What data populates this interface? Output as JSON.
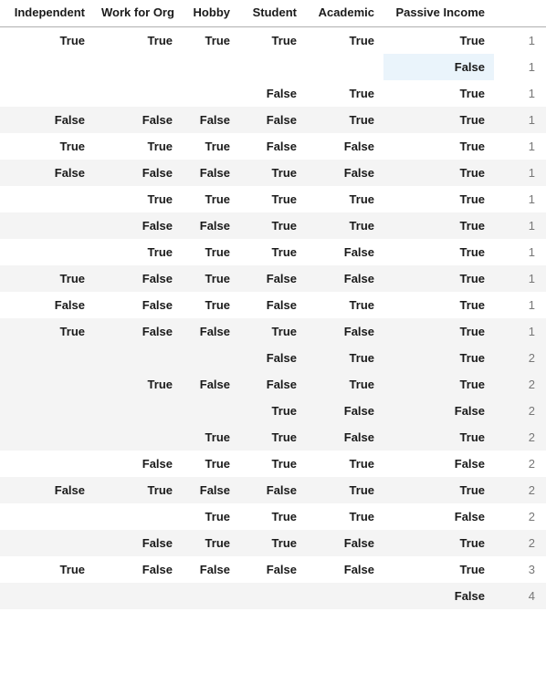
{
  "columns": [
    {
      "key": "independent",
      "label": "Independent"
    },
    {
      "key": "workfororg",
      "label": "Work for Org"
    },
    {
      "key": "hobby",
      "label": "Hobby"
    },
    {
      "key": "student",
      "label": "Student"
    },
    {
      "key": "academic",
      "label": "Academic"
    },
    {
      "key": "passiveincome",
      "label": "Passive Income"
    }
  ],
  "rows": [
    {
      "independent": "True",
      "workfororg": "True",
      "hobby": "True",
      "student": "True",
      "academic": "True",
      "passiveincome": "True",
      "count": "1"
    },
    {
      "independent": "",
      "workfororg": "",
      "hobby": "",
      "student": "",
      "academic": "",
      "passiveincome": "False",
      "count": "1",
      "passive_highlight": true
    },
    {
      "independent": "",
      "workfororg": "",
      "hobby": "",
      "student": "False",
      "academic": "True",
      "passiveincome": "True",
      "count": "1"
    },
    {
      "independent": "False",
      "workfororg": "False",
      "hobby": "False",
      "student": "False",
      "academic": "True",
      "passiveincome": "True",
      "count": "1"
    },
    {
      "independent": "True",
      "workfororg": "True",
      "hobby": "True",
      "student": "False",
      "academic": "False",
      "passiveincome": "True",
      "count": "1"
    },
    {
      "independent": "False",
      "workfororg": "False",
      "hobby": "False",
      "student": "True",
      "academic": "False",
      "passiveincome": "True",
      "count": "1"
    },
    {
      "independent": "",
      "workfororg": "True",
      "hobby": "True",
      "student": "True",
      "academic": "True",
      "passiveincome": "True",
      "count": "1"
    },
    {
      "independent": "",
      "workfororg": "False",
      "hobby": "False",
      "student": "True",
      "academic": "True",
      "passiveincome": "True",
      "count": "1"
    },
    {
      "independent": "",
      "workfororg": "True",
      "hobby": "True",
      "student": "True",
      "academic": "False",
      "passiveincome": "True",
      "count": "1"
    },
    {
      "independent": "True",
      "workfororg": "False",
      "hobby": "True",
      "student": "False",
      "academic": "False",
      "passiveincome": "True",
      "count": "1"
    },
    {
      "independent": "False",
      "workfororg": "False",
      "hobby": "True",
      "student": "False",
      "academic": "True",
      "passiveincome": "True",
      "count": "1"
    },
    {
      "independent": "True",
      "workfororg": "False",
      "hobby": "False",
      "student": "True",
      "academic": "False",
      "passiveincome": "True",
      "count": "1"
    },
    {
      "independent": "",
      "workfororg": "",
      "hobby": "",
      "student": "False",
      "academic": "True",
      "passiveincome": "True",
      "count": "2"
    },
    {
      "independent": "",
      "workfororg": "True",
      "hobby": "False",
      "student": "False",
      "academic": "True",
      "passiveincome": "True",
      "count": "2"
    },
    {
      "independent": "",
      "workfororg": "",
      "hobby": "",
      "student": "True",
      "academic": "False",
      "passiveincome": "False",
      "count": "2"
    },
    {
      "independent": "",
      "workfororg": "",
      "hobby": "True",
      "student": "True",
      "academic": "False",
      "passiveincome": "True",
      "count": "2"
    },
    {
      "independent": "",
      "workfororg": "False",
      "hobby": "True",
      "student": "True",
      "academic": "True",
      "passiveincome": "False",
      "count": "2"
    },
    {
      "independent": "False",
      "workfororg": "True",
      "hobby": "False",
      "student": "False",
      "academic": "True",
      "passiveincome": "True",
      "count": "2"
    },
    {
      "independent": "",
      "workfororg": "",
      "hobby": "True",
      "student": "True",
      "academic": "True",
      "passiveincome": "False",
      "count": "2"
    },
    {
      "independent": "",
      "workfororg": "False",
      "hobby": "True",
      "student": "True",
      "academic": "False",
      "passiveincome": "True",
      "count": "2"
    },
    {
      "independent": "True",
      "workfororg": "False",
      "hobby": "False",
      "student": "False",
      "academic": "False",
      "passiveincome": "True",
      "count": "3"
    },
    {
      "independent": "",
      "workfororg": "",
      "hobby": "",
      "student": "",
      "academic": "",
      "passiveincome": "False",
      "count": "4"
    }
  ],
  "row_shading": [
    "w",
    "w",
    "w",
    "g",
    "w",
    "g",
    "w",
    "g",
    "w",
    "g",
    "w",
    "g",
    "g",
    "g",
    "g",
    "g",
    "w",
    "g",
    "w",
    "g",
    "w",
    "g"
  ]
}
